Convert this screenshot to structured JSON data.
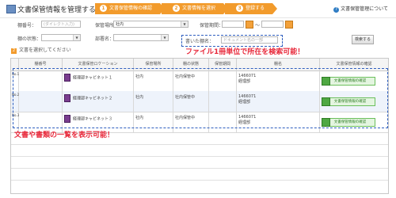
{
  "header": {
    "title": "文書保管情報を管理する",
    "help": "文書保管管理について",
    "steps": [
      {
        "num": "1",
        "label": "文書保管情報の確認"
      },
      {
        "num": "2",
        "label": "文書情報を選択"
      },
      {
        "num": "3",
        "label": "登録する"
      }
    ]
  },
  "filters": {
    "doc_no_label": "棚番号：",
    "doc_no_placeholder": "(ダイレクト入力)",
    "location_label": "保管場所：",
    "location_value": "社内",
    "date_label": "保管期間：",
    "date_sep": "～",
    "status_label": "棚の状態：",
    "status_value": "",
    "dept_label": "部署名：",
    "dept_value": "",
    "keyword_label": "書いた棚名：",
    "keyword_placeholder": "ドキュメント名の一部",
    "search_button": "検索する"
  },
  "callouts": {
    "top": "ファイル1冊単位で所在を検索可能！",
    "mid": "文書や書類の一覧を表示可能！"
  },
  "select_all": {
    "num": "2",
    "label": "文書を選択してください"
  },
  "table": {
    "headers": [
      "棚番号",
      "文書保管ロケーション",
      "保管場所",
      "棚の状態",
      "保管期間",
      "棚名",
      "文書保管情報の確認"
    ],
    "rows": [
      {
        "check": "No.1",
        "location": "経理部キャビネット１",
        "place": "社内",
        "status": "社内保管中",
        "period": "",
        "name1": "1466071",
        "name2": "経理部",
        "action": "文書保管情報の確認"
      },
      {
        "check": "No.2",
        "location": "経理部キャビネット２",
        "place": "社内",
        "status": "社内保管中",
        "period": "",
        "name1": "1466071",
        "name2": "経理部",
        "action": "文書保管情報の確認"
      },
      {
        "check": "No.3",
        "location": "経理部キャビネット３",
        "place": "社内",
        "status": "社内保管中",
        "period": "",
        "name1": "1466071",
        "name2": "経理部",
        "action": "文書保管情報の確認"
      }
    ]
  },
  "colors": {
    "accent": "#f29b2c",
    "callout": "#e8293b",
    "dash": "#2f5fbf"
  }
}
